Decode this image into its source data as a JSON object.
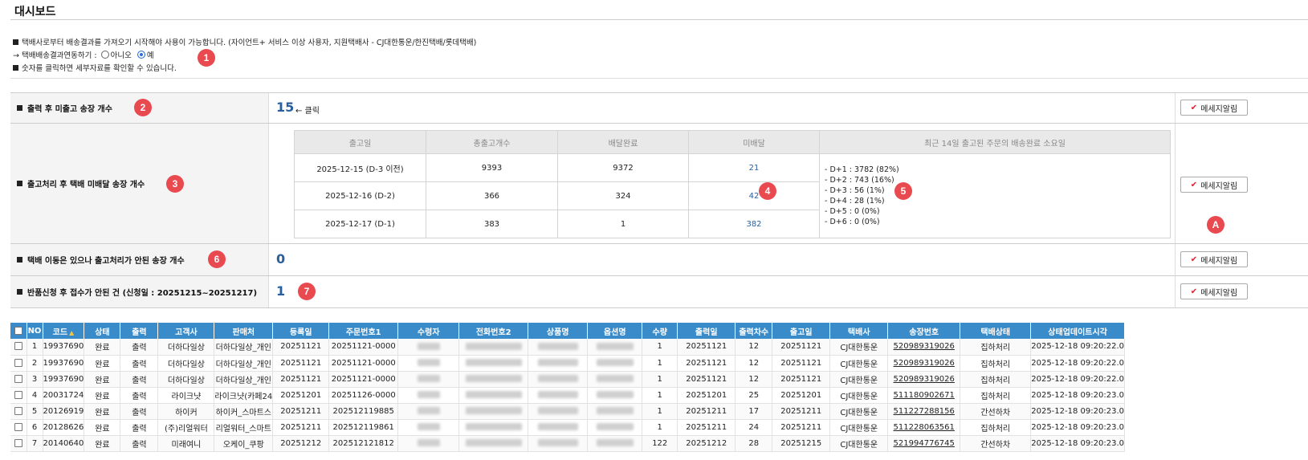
{
  "page": {
    "title": "대시보드"
  },
  "notice": {
    "line1": "택배사로부터 배송결과를 가져오기 시작해야 사용이 가능합니다. (자이언트+ 서비스 이상 사용자, 지원택배사 - CJ대한통운/한진택배/롯데택배)",
    "line2_prefix": "→ 택배배송결과연동하기 : ",
    "option_no": "아니오",
    "option_yes": "예",
    "selected": "예",
    "line3": "숫자를 클릭하면 세부자료를 확인할 수 있습니다."
  },
  "badges": [
    "1",
    "2",
    "3",
    "4",
    "5",
    "6",
    "7",
    "A"
  ],
  "message_button_label": "메세지알림",
  "rows": {
    "unshipped": {
      "label": "출력 후 미출고 송장 개수",
      "count": "15",
      "note": "← 클릭"
    },
    "undelivered": {
      "label": "출고처리 후 택배 미배달 송장 개수",
      "headers": [
        "출고일",
        "총출고개수",
        "배달완료",
        "미배달",
        "최근 14일 출고된 주문의 배송완료 소요일"
      ],
      "rows": [
        {
          "date": "2025-12-15 (D-3 이전)",
          "total": "9393",
          "done": "9372",
          "pending": "21"
        },
        {
          "date": "2025-12-16 (D-2)",
          "total": "366",
          "done": "324",
          "pending": "42"
        },
        {
          "date": "2025-12-17 (D-1)",
          "total": "383",
          "done": "1",
          "pending": "382"
        }
      ],
      "stats": [
        "- D+1 : 3782 (82%)",
        "- D+2 : 743 (16%)",
        "- D+3 : 56 (1%)",
        "- D+4 : 28 (1%)",
        "- D+5 : 0 (0%)",
        "- D+6 : 0 (0%)"
      ]
    },
    "moved": {
      "label": "택배 이동은 있으나 출고처리가 안된 송장 개수",
      "count": "0"
    },
    "returns": {
      "label": "반품신청 후 접수가 안된 건 (신청일 : 20251215~20251217)",
      "count": "1"
    }
  },
  "grid": {
    "headers": [
      "NO",
      "코드",
      "상태",
      "출력",
      "고객사",
      "판매처",
      "등록일",
      "주문번호1",
      "수령자",
      "전화번호2",
      "상품명",
      "옵션명",
      "수량",
      "출력일",
      "출력차수",
      "출고일",
      "택배사",
      "송장번호",
      "택배상태",
      "상태업데이트시각"
    ],
    "rows": [
      [
        "1",
        "19937690",
        "완료",
        "출력",
        "더하다일상",
        "더하다일상_개인",
        "20251121",
        "20251121-0000",
        "",
        "",
        "",
        "",
        "1",
        "20251121",
        "12",
        "20251121",
        "CJ대한통운",
        "520989319026",
        "집하처리",
        "2025-12-18 09:20:22.0"
      ],
      [
        "2",
        "19937690",
        "완료",
        "출력",
        "더하다일상",
        "더하다일상_개인",
        "20251121",
        "20251121-0000",
        "",
        "",
        "",
        "",
        "1",
        "20251121",
        "12",
        "20251121",
        "CJ대한통운",
        "520989319026",
        "집하처리",
        "2025-12-18 09:20:22.0"
      ],
      [
        "3",
        "19937690",
        "완료",
        "출력",
        "더하다일상",
        "더하다일상_개인",
        "20251121",
        "20251121-0000",
        "",
        "",
        "",
        "",
        "1",
        "20251121",
        "12",
        "20251121",
        "CJ대한통운",
        "520989319026",
        "집하처리",
        "2025-12-18 09:20:22.0"
      ],
      [
        "4",
        "20031724",
        "완료",
        "출력",
        "라이크냣",
        "라이크냣(카페24",
        "20251201",
        "20251126-0000",
        "",
        "",
        "",
        "",
        "1",
        "20251201",
        "25",
        "20251201",
        "CJ대한통운",
        "511180902671",
        "집하처리",
        "2025-12-18 09:20:23.0"
      ],
      [
        "5",
        "20126919",
        "완료",
        "출력",
        "하이커",
        "하이커_스마트스",
        "20251211",
        "202512119885",
        "",
        "",
        "",
        "",
        "1",
        "20251211",
        "17",
        "20251211",
        "CJ대한통운",
        "511227288156",
        "간선하차",
        "2025-12-18 09:20:23.0"
      ],
      [
        "6",
        "20128626",
        "완료",
        "출력",
        "(주)리얼워터",
        "리얼워터_스마트",
        "20251211",
        "202512119861",
        "",
        "",
        "",
        "",
        "1",
        "20251211",
        "24",
        "20251211",
        "CJ대한통운",
        "511228063561",
        "집하처리",
        "2025-12-18 09:20:23.0"
      ],
      [
        "7",
        "20140640",
        "완료",
        "출력",
        "미래여니",
        "오케이_쿠팡",
        "20251212",
        "202512121812",
        "",
        "",
        "",
        "",
        "122",
        "20251212",
        "28",
        "20251215",
        "CJ대한통운",
        "521994776745",
        "간선하차",
        "2025-12-18 09:20:23.0"
      ]
    ]
  }
}
